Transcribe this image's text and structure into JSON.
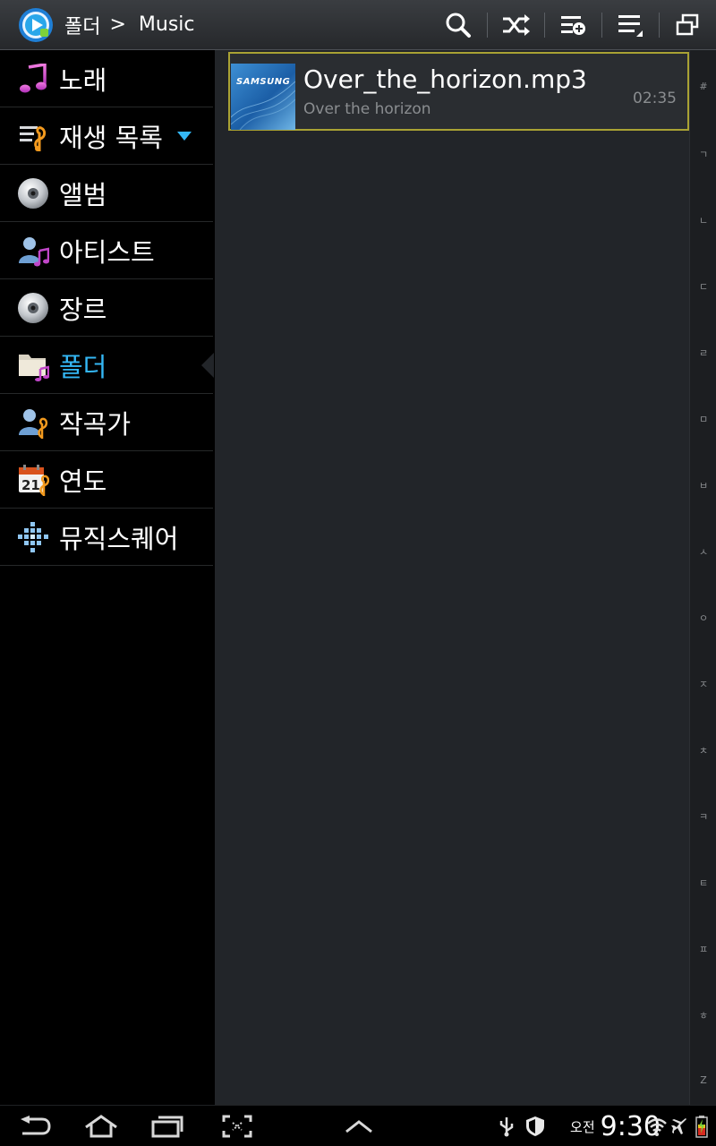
{
  "header": {
    "breadcrumb_root": "폴더",
    "breadcrumb_sep": ">",
    "breadcrumb_current": "Music",
    "toolbar_icons": [
      "search-icon",
      "shuffle-icon",
      "add-to-playlist-icon",
      "list-options-icon",
      "window-icon"
    ]
  },
  "sidebar": {
    "items": [
      {
        "label": "노래",
        "icon": "music-note-icon"
      },
      {
        "label": "재생 목록",
        "icon": "playlist-icon"
      },
      {
        "label": "앨범",
        "icon": "album-disc-icon"
      },
      {
        "label": "아티스트",
        "icon": "artist-icon"
      },
      {
        "label": "장르",
        "icon": "genre-disc-icon"
      },
      {
        "label": "폴더",
        "icon": "folder-music-icon"
      },
      {
        "label": "작곡가",
        "icon": "composer-icon"
      },
      {
        "label": "연도",
        "icon": "calendar-year-icon"
      },
      {
        "label": "뮤직스퀘어",
        "icon": "music-square-icon"
      }
    ],
    "active_item": "폴더"
  },
  "main": {
    "songs": [
      {
        "title": "Over_the_horizon.mp3",
        "subtitle": "Over the horizon",
        "duration": "02:35",
        "thumb_brand": "SAMSUNG"
      }
    ]
  },
  "index_bar": [
    "#",
    "ㄱ",
    "ㄴ",
    "ㄷ",
    "ㄹ",
    "ㅁ",
    "ㅂ",
    "ㅅ",
    "ㅇ",
    "ㅈ",
    "ㅊ",
    "ㅋ",
    "ㅌ",
    "ㅍ",
    "ㅎ",
    "Z"
  ],
  "system_bar": {
    "ampm": "오전",
    "time": "9:30",
    "nav_icons": [
      "back-icon",
      "home-icon",
      "recent-apps-icon",
      "screenshot-icon",
      "up-chevron-icon"
    ],
    "status_icons": [
      "usb-icon",
      "shield-icon",
      "wifi-icon",
      "airplane-icon",
      "battery-icon"
    ]
  },
  "colors": {
    "accent": "#34b7f5",
    "selection_border": "#a9a234",
    "panel_bg": "#222529"
  }
}
